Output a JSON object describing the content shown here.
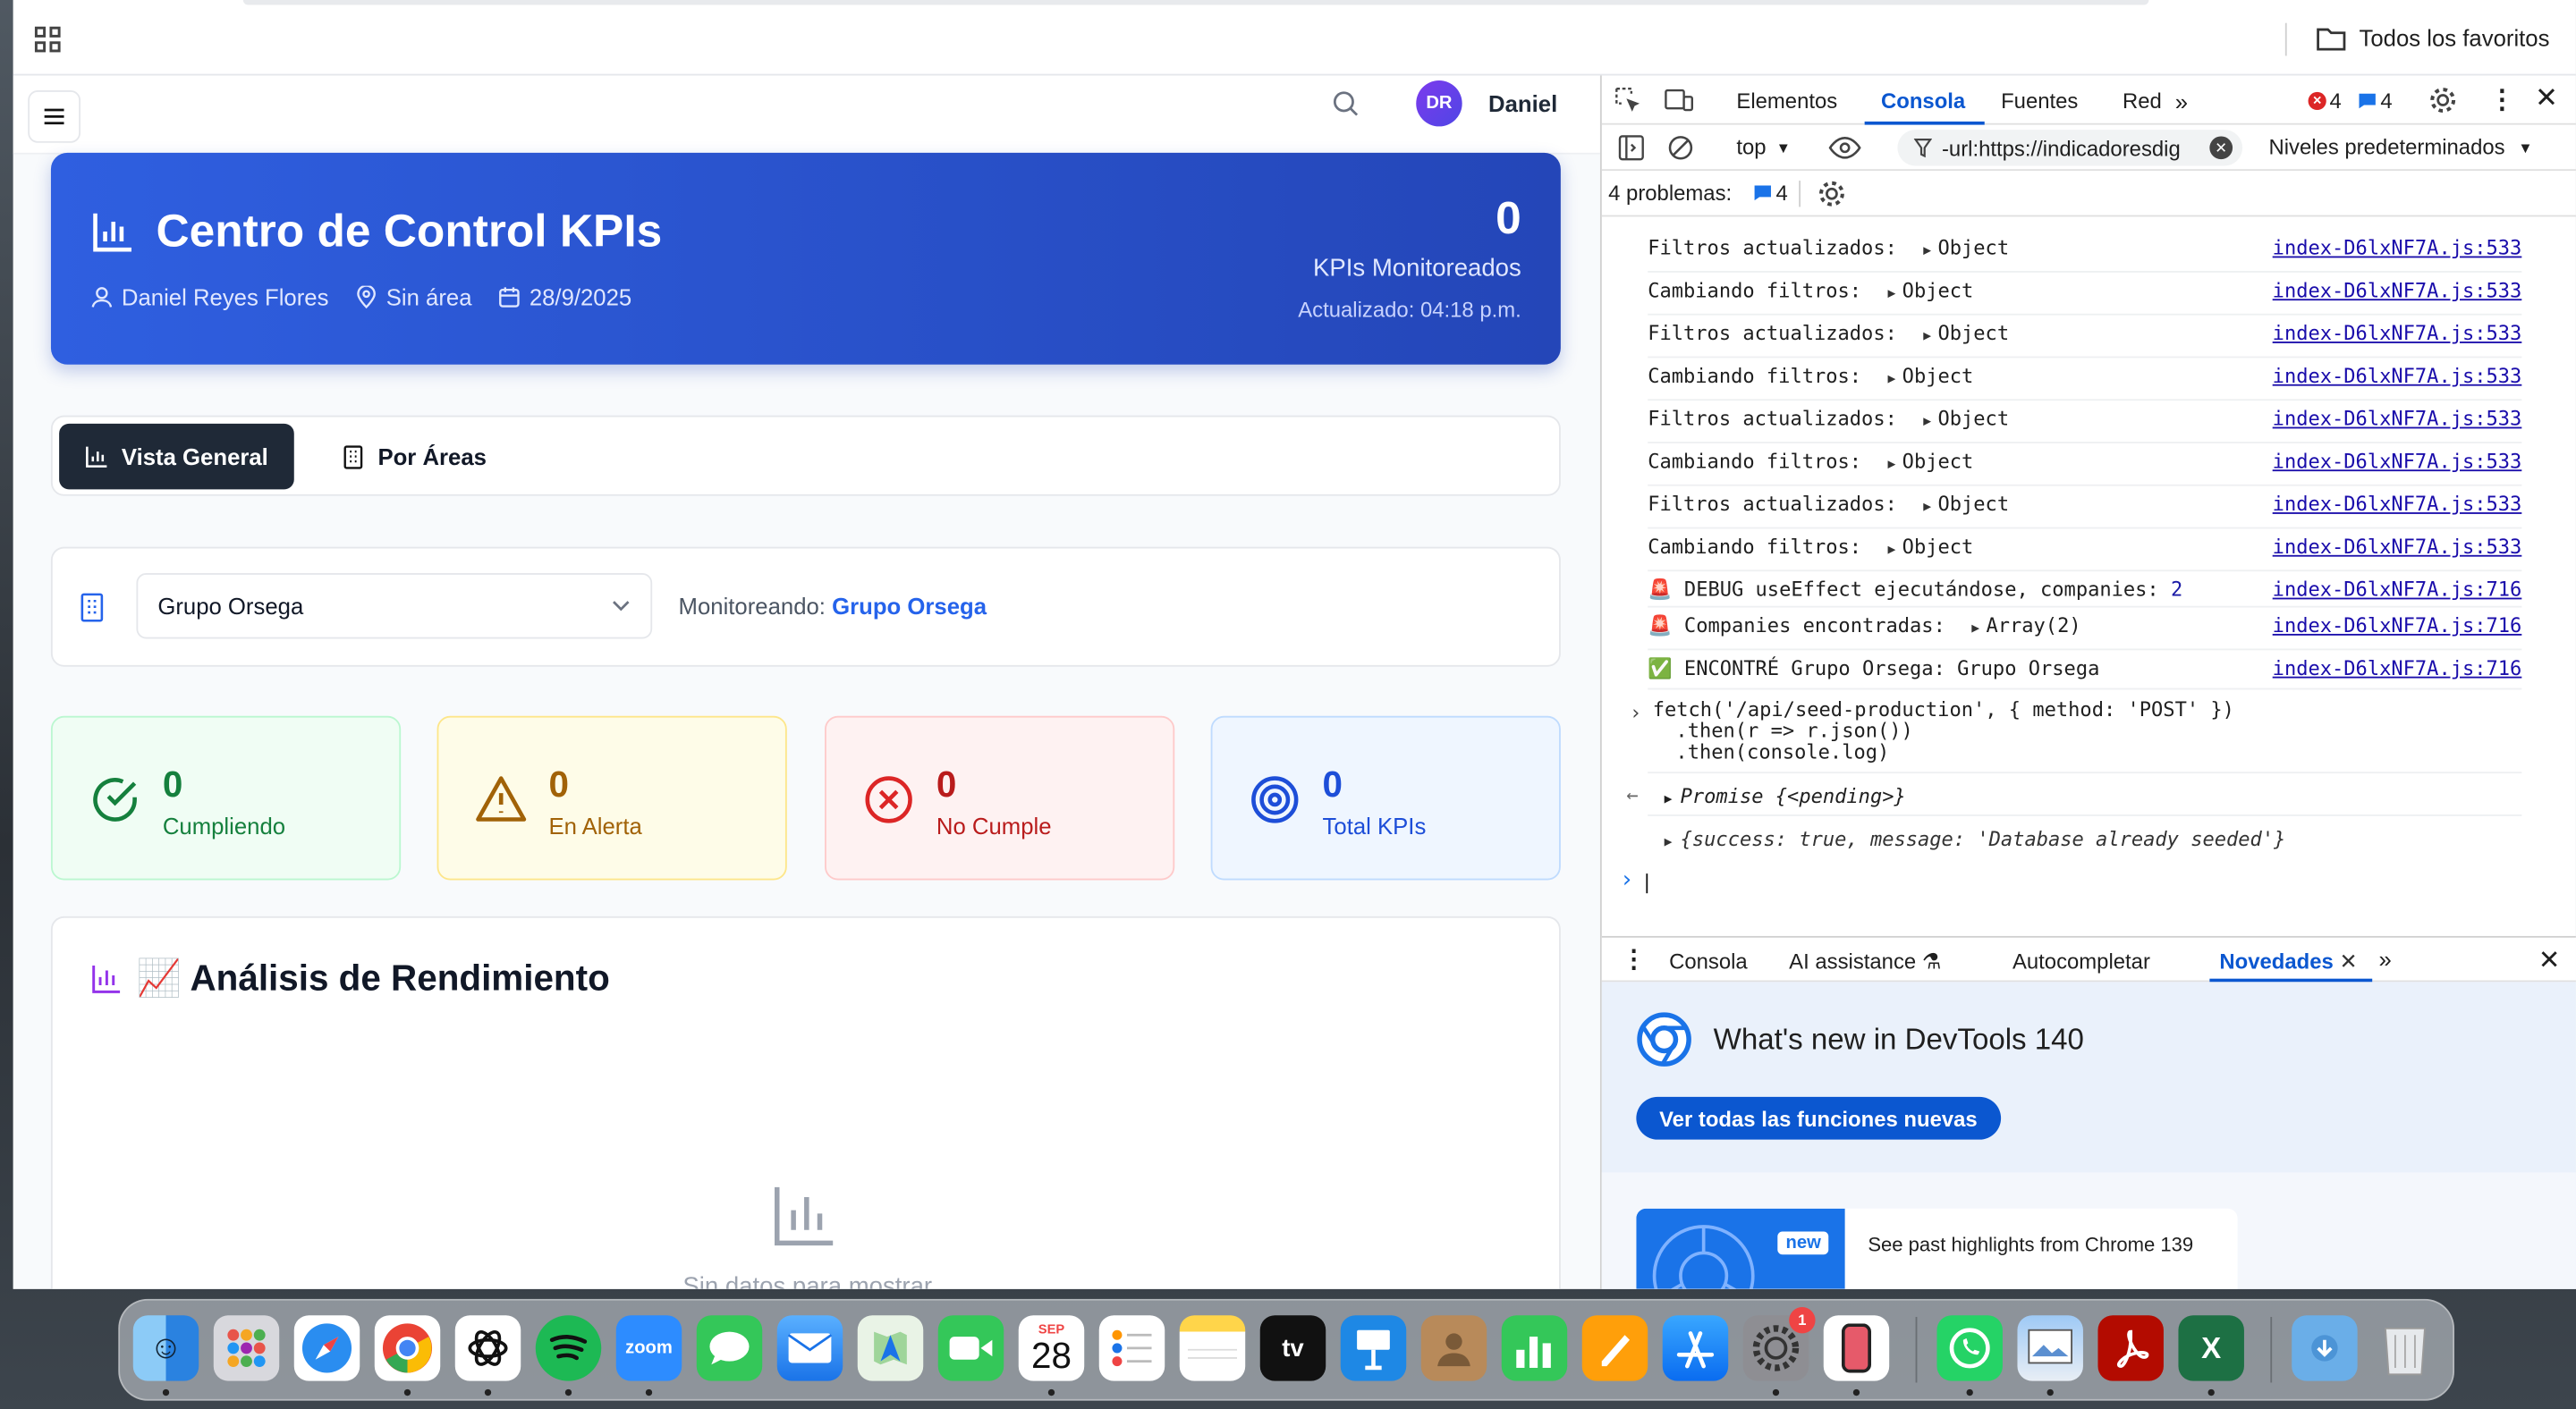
{
  "browser": {
    "favorites_label": "Todos los favoritos"
  },
  "app": {
    "user_initials": "DR",
    "user_name": "Daniel",
    "hero": {
      "title": "Centro de Control KPIs",
      "person": "Daniel Reyes Flores",
      "area": "Sin área",
      "date": "28/9/2025",
      "count": "0",
      "count_label": "KPIs Monitoreados",
      "updated": "Actualizado: 04:18 p.m."
    },
    "tabs": [
      {
        "label": "Vista General"
      },
      {
        "label": "Por Áreas"
      }
    ],
    "company_select": "Grupo Orsega",
    "monitoring_label": "Monitoreando:",
    "monitoring_value": "Grupo Orsega",
    "cards": [
      {
        "value": "0",
        "label": "Cumpliendo",
        "color": "#15803d"
      },
      {
        "value": "0",
        "label": "En Alerta",
        "color": "#a16207"
      },
      {
        "value": "0",
        "label": "No Cumple",
        "color": "#b91c1c"
      },
      {
        "value": "0",
        "label": "Total KPIs",
        "color": "#1d4ed8"
      }
    ],
    "performance_title": "📈 Análisis de Rendimiento",
    "empty_text": "Sin datos para mostrar"
  },
  "devtools": {
    "tabs": [
      "Elementos",
      "Consola",
      "Fuentes",
      "Red"
    ],
    "errors": "4",
    "messages": "4",
    "context": "top",
    "filter": "-url:https://indicadoresdig",
    "levels": "Niveles predeterminados",
    "problems_label": "4 problemas:",
    "problems_count": "4",
    "logs": [
      {
        "text": "Filtros actualizados:",
        "obj": "Object",
        "src": "index-D6lxNF7A.js:533"
      },
      {
        "text": "Cambiando filtros:",
        "obj": "Object",
        "src": "index-D6lxNF7A.js:533"
      },
      {
        "text": "Filtros actualizados:",
        "obj": "Object",
        "src": "index-D6lxNF7A.js:533"
      },
      {
        "text": "Cambiando filtros:",
        "obj": "Object",
        "src": "index-D6lxNF7A.js:533"
      },
      {
        "text": "Filtros actualizados:",
        "obj": "Object",
        "src": "index-D6lxNF7A.js:533"
      },
      {
        "text": "Cambiando filtros:",
        "obj": "Object",
        "src": "index-D6lxNF7A.js:533"
      },
      {
        "text": "Filtros actualizados:",
        "obj": "Object",
        "src": "index-D6lxNF7A.js:533"
      },
      {
        "text": "Cambiando filtros:",
        "obj": "Object",
        "src": "index-D6lxNF7A.js:533"
      },
      {
        "text": "🚨 DEBUG useEffect ejecutándose, companies:",
        "obj": "2",
        "src": "index-D6lxNF7A.js:716"
      },
      {
        "text": "🚨 Companies encontradas:",
        "obj": "Array(2)",
        "src": "index-D6lxNF7A.js:716"
      },
      {
        "text": "✅ ENCONTRÉ Grupo Orsega: Grupo Orsega",
        "obj": "",
        "src": "index-D6lxNF7A.js:716"
      }
    ],
    "cmd1": "fetch('/api/seed-production', { method: 'POST' })",
    "cmd2": ".then(r => r.json())",
    "cmd3": ".then(console.log)",
    "promise": "Promise {<pending>}",
    "result": "{success: true, message: 'Database already seeded'}",
    "drawer_tabs": [
      "Consola",
      "AI assistance",
      "Autocompletar",
      "Novedades"
    ],
    "news_title": "What's new in DevTools 140",
    "news_button": "Ver todas las funciones nuevas",
    "news_badge": "new",
    "news_highlight": "See past highlights from Chrome 139"
  },
  "dock": {
    "calendar_month": "SEP",
    "calendar_day": "28",
    "zoom_label": "zoom",
    "tv_label": "tv",
    "settings_badge": "1"
  }
}
